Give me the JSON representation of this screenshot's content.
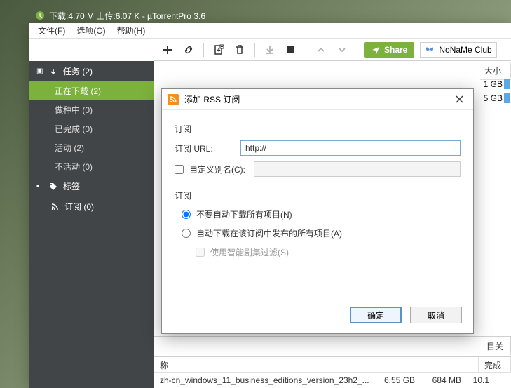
{
  "titlebar": {
    "text": "下载:4.70 M 上传:6.07 K - µTorrentPro 3.6"
  },
  "menubar": [
    "文件(F)",
    "选项(O)",
    "帮助(H)"
  ],
  "share_label": "Share",
  "bundle_label": "NoNaMe Club",
  "sidebar": {
    "tasks_header": "任务  (2)",
    "items": [
      {
        "label": "正在下载 (2)",
        "active": true
      },
      {
        "label": "做种中 (0)"
      },
      {
        "label": "已完成 (0)"
      },
      {
        "label": "活动 (2)"
      },
      {
        "label": "不活动 (0)"
      }
    ],
    "labels_header": "标签",
    "feeds_header": "订阅 (0)"
  },
  "header_cols": {
    "size": "大小"
  },
  "rows": [
    {
      "size": "1 GB"
    },
    {
      "size": "5 GB"
    }
  ],
  "dialog": {
    "title": "添加 RSS 订阅",
    "section1": "订阅",
    "url_label": "订阅 URL:",
    "url_value": "http://",
    "alias_chk": "自定义别名(C):",
    "section2": "订阅",
    "opt1": "不要自动下载所有项目(N)",
    "opt2": "自动下载在该订阅中发布的所有项目(A)",
    "smart": "使用智能剧集过滤(S)",
    "ok": "确定",
    "cancel": "取消"
  },
  "detail_tabs": {
    "related": "目关"
  },
  "bottom": {
    "cols": {
      "name": "称",
      "done": "完成"
    },
    "row": {
      "name": "zh-cn_windows_11_business_editions_version_23h2_...",
      "size": "6.55 GB",
      "done": "684 MB",
      "pct": "10.1"
    }
  }
}
